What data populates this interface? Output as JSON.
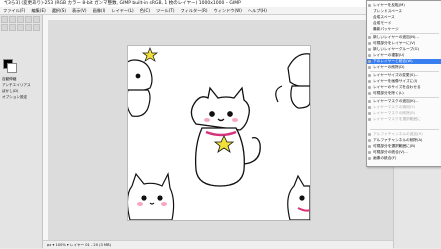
{
  "window": {
    "title": "*[3ら3] (変更あり)-253 (RGB カラー 8-bit ガンマ整数, GIMP built-in sRGB, 1 枚のレイヤー) 1000x1000 – GIMP",
    "controls": [
      "—",
      "□",
      "✕"
    ]
  },
  "menubar": [
    "ファイル(F)",
    "編集(E)",
    "選択(S)",
    "表示(V)",
    "画像(I)",
    "レイヤー(L)",
    "色(C)",
    "ツール(T)",
    "フィルター(R)",
    "ウィンドウ(W)",
    "ヘルプ(H)"
  ],
  "toolbox": {
    "options": [
      "自動伸縮",
      "アンチエイリアス",
      "ぼかし(D)",
      "オプション設定"
    ]
  },
  "statusbar": {
    "text": "px ▾  100% ▾  レイヤー 01 - 20 (3 MB)"
  },
  "context_menu": {
    "items": [
      {
        "label": "レイヤーを反転(M)",
        "state": "normal"
      },
      {
        "label": "ブレンドスペース",
        "state": "normal"
      },
      {
        "label": "合成スペース",
        "state": "normal"
      },
      {
        "label": "合成モード",
        "state": "normal"
      },
      {
        "label": "最新パッケージ",
        "state": "normal"
      },
      {
        "label": "新しいレイヤーの追加(N)...",
        "state": "normal"
      },
      {
        "label": "可視部分をレイヤーに(V)",
        "state": "normal"
      },
      {
        "label": "新しいレイヤーグループ(G)",
        "state": "normal"
      },
      {
        "label": "レイヤーの複製(U)",
        "state": "normal"
      },
      {
        "label": "下のレイヤーと統合(W)",
        "state": "highlighted"
      },
      {
        "label": "レイヤーの削除(D)",
        "state": "normal"
      },
      {
        "label": "レイヤーサイズの変更(S)...",
        "state": "normal"
      },
      {
        "label": "レイヤーを画像サイズに(I)",
        "state": "normal"
      },
      {
        "label": "レイヤーのサイズを合わせる",
        "state": "normal"
      },
      {
        "label": "可視部分を除く(L)",
        "state": "normal"
      },
      {
        "label": "レイヤーマスクの追加(K)...",
        "state": "normal"
      },
      {
        "label": "レイヤーマスクの適用(Y)",
        "state": "disabled"
      },
      {
        "label": "レイヤーマスクの削除(R)",
        "state": "disabled"
      },
      {
        "label": "レイヤーマスクを選択範囲に",
        "state": "disabled"
      },
      {
        "label": "アルファチャンネルの追加(H)",
        "state": "disabled"
      },
      {
        "label": "アルファチャンネルの削除(A)",
        "state": "normal"
      },
      {
        "label": "可視部分を選択範囲に(B)",
        "state": "normal"
      },
      {
        "label": "可視部分の統合(V)...",
        "state": "normal"
      },
      {
        "label": "画像の統合(F)",
        "state": "normal"
      }
    ]
  },
  "colors": {
    "accent": "#3a7ff0",
    "collar": "#d6337e",
    "star": "#f2e03a"
  }
}
